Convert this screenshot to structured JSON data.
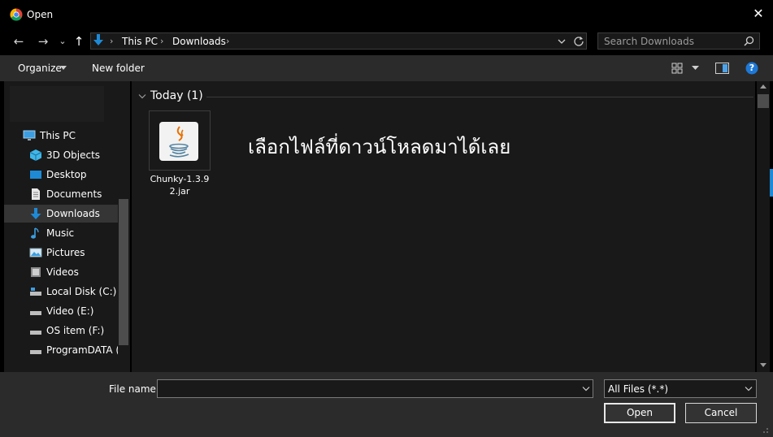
{
  "window": {
    "title": "Open",
    "close_label": "✕"
  },
  "nav": {
    "back": "←",
    "forward": "→",
    "recent": "⌄",
    "up": "↑"
  },
  "address": {
    "crumbs": [
      "This PC",
      "Downloads"
    ],
    "separator": "›"
  },
  "search": {
    "placeholder": "Search Downloads"
  },
  "toolbar": {
    "organize": "Organize",
    "new_folder": "New folder",
    "help": "?"
  },
  "sidebar": {
    "items": [
      {
        "label": "This PC",
        "icon": "computer-icon"
      },
      {
        "label": "3D Objects",
        "icon": "cube-icon"
      },
      {
        "label": "Desktop",
        "icon": "desktop-icon"
      },
      {
        "label": "Documents",
        "icon": "document-icon"
      },
      {
        "label": "Downloads",
        "icon": "download-icon",
        "selected": true
      },
      {
        "label": "Music",
        "icon": "music-icon"
      },
      {
        "label": "Pictures",
        "icon": "pictures-icon"
      },
      {
        "label": "Videos",
        "icon": "video-icon"
      },
      {
        "label": "Local Disk (C:)",
        "icon": "drive-icon"
      },
      {
        "label": "Video (E:)",
        "icon": "drive-icon"
      },
      {
        "label": "OS item (F:)",
        "icon": "drive-icon"
      },
      {
        "label": "ProgramDATA (C",
        "icon": "drive-icon"
      }
    ]
  },
  "main": {
    "group_title": "Today (1)",
    "files": [
      {
        "name": "Chunky-1.3.92.jar",
        "icon": "java-icon"
      }
    ],
    "overlay_text": "เลือกไฟล์ที่ดาวน์โหลดมาได้เลย"
  },
  "bottom": {
    "file_name_label": "File name:",
    "file_name_value": "",
    "filter_value": "All Files (*.*)",
    "open_label": "Open",
    "cancel_label": "Cancel"
  },
  "colors": {
    "accent": "#1e8ad6",
    "background": "#191919",
    "toolbar": "#2b2b2b"
  }
}
